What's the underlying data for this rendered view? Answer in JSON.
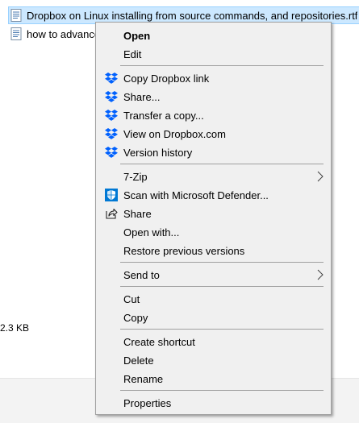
{
  "explorer": {
    "files": [
      {
        "name": "Dropbox on Linux installing from source commands, and repositories.rtf",
        "selected": true
      },
      {
        "name": "how to advanced",
        "selected": false
      }
    ],
    "size_text": "2.3 KB"
  },
  "context_menu": {
    "open": "Open",
    "edit": "Edit",
    "copy_dropbox_link": "Copy Dropbox link",
    "share_dots": "Share...",
    "transfer_copy": "Transfer a copy...",
    "view_on_dropbox": "View on Dropbox.com",
    "version_history": "Version history",
    "seven_zip": "7-Zip",
    "scan_defender": "Scan with Microsoft Defender...",
    "share": "Share",
    "open_with": "Open with...",
    "restore_previous": "Restore previous versions",
    "send_to": "Send to",
    "cut": "Cut",
    "copy": "Copy",
    "create_shortcut": "Create shortcut",
    "delete": "Delete",
    "rename": "Rename",
    "properties": "Properties"
  },
  "colors": {
    "dropbox_blue": "#0061fe",
    "defender_blue": "#0078d4",
    "selection_bg": "#cce8ff",
    "menu_bg": "#f0f0f0"
  },
  "icons": {
    "dropbox": "dropbox-icon",
    "defender": "defender-shield-icon",
    "share": "share-icon",
    "submenu": "chevron-right-icon",
    "file": "document-icon"
  }
}
